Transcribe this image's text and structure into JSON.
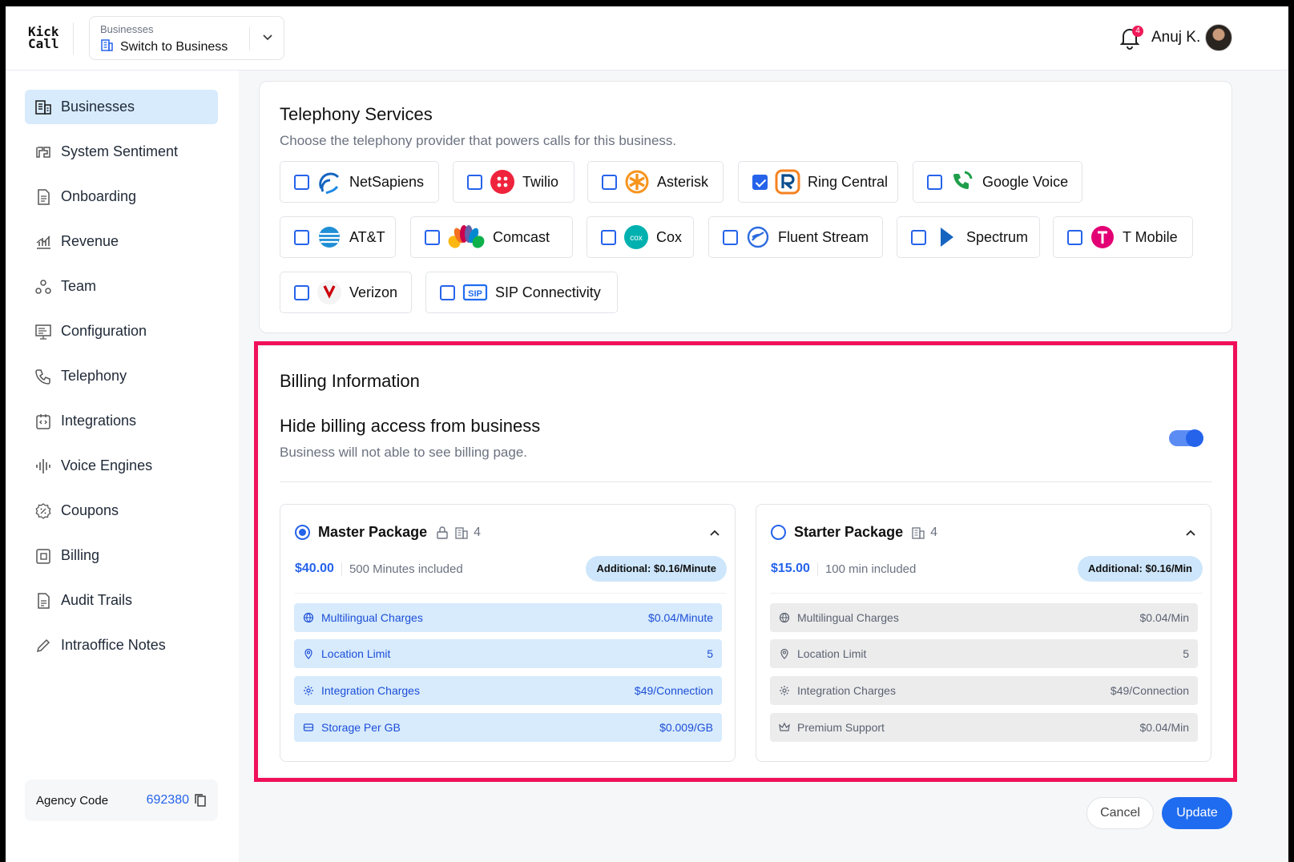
{
  "header": {
    "logo": [
      "Kick",
      "Call"
    ],
    "switcher_caption": "Businesses",
    "switcher_value": "Switch to Business",
    "notification_count": "4",
    "user_name": "Anuj K."
  },
  "sidebar": {
    "items": [
      {
        "label": "Businesses",
        "icon": "building-icon"
      },
      {
        "label": "System Sentiment",
        "icon": "sentiment-icon"
      },
      {
        "label": "Onboarding",
        "icon": "document-icon"
      },
      {
        "label": "Revenue",
        "icon": "chart-icon"
      },
      {
        "label": "Team",
        "icon": "team-icon"
      },
      {
        "label": "Configuration",
        "icon": "monitor-icon"
      },
      {
        "label": "Telephony",
        "icon": "phone-icon"
      },
      {
        "label": "Integrations",
        "icon": "code-icon"
      },
      {
        "label": "Voice Engines",
        "icon": "waveform-icon"
      },
      {
        "label": "Coupons",
        "icon": "coupon-icon"
      },
      {
        "label": "Billing",
        "icon": "wallet-icon"
      },
      {
        "label": "Audit Trails",
        "icon": "file-icon"
      },
      {
        "label": "Intraoffice Notes",
        "icon": "pencil-icon"
      }
    ],
    "agency_label": "Agency Code",
    "agency_code": "692380"
  },
  "telephony": {
    "title": "Telephony Services",
    "subtitle": "Choose the telephony provider that powers calls for this business.",
    "providers": [
      {
        "name": "NetSapiens",
        "checked": false
      },
      {
        "name": "Twilio",
        "checked": false
      },
      {
        "name": "Asterisk",
        "checked": false
      },
      {
        "name": "Ring Central",
        "checked": true
      },
      {
        "name": "Google Voice",
        "checked": false
      },
      {
        "name": "AT&T",
        "checked": false
      },
      {
        "name": "Comcast",
        "checked": false
      },
      {
        "name": "Cox",
        "checked": false
      },
      {
        "name": "Fluent Stream",
        "checked": false
      },
      {
        "name": "Spectrum",
        "checked": false
      },
      {
        "name": "T Mobile",
        "checked": false
      },
      {
        "name": "Verizon",
        "checked": false
      },
      {
        "name": "SIP Connectivity",
        "checked": false
      }
    ]
  },
  "billing": {
    "title": "Billing Information",
    "toggle_title": "Hide billing access from business",
    "toggle_sub": "Business will not able to see billing page.",
    "toggle_on": true,
    "packages": [
      {
        "name": "Master Package",
        "selected": true,
        "count": "4",
        "price": "$40.00",
        "included": "500 Minutes included",
        "additional": "Additional: $0.16/Minute",
        "features": [
          {
            "label": "Multilingual Charges",
            "value": "$0.04/Minute",
            "icon": "globe-icon"
          },
          {
            "label": "Location Limit",
            "value": "5",
            "icon": "location-pin-icon"
          },
          {
            "label": "Integration Charges",
            "value": "$49/Connection",
            "icon": "gear-icon"
          },
          {
            "label": "Storage Per GB",
            "value": "$0.009/GB",
            "icon": "storage-icon"
          }
        ]
      },
      {
        "name": "Starter Package",
        "selected": false,
        "count": "4",
        "price": "$15.00",
        "included": "100 min included",
        "additional": "Additional: $0.16/Min",
        "features": [
          {
            "label": "Multilingual Charges",
            "value": "$0.04/Min",
            "icon": "globe-icon"
          },
          {
            "label": "Location Limit",
            "value": "5",
            "icon": "location-pin-icon"
          },
          {
            "label": "Integration Charges",
            "value": "$49/Connection",
            "icon": "gear-icon"
          },
          {
            "label": "Premium Support",
            "value": "$0.04/Min",
            "icon": "crown-icon"
          }
        ]
      }
    ]
  },
  "actions": {
    "cancel": "Cancel",
    "update": "Update"
  },
  "colors": {
    "accent": "#2563eb",
    "highlight_border": "#f0105a",
    "active_nav": "#d7ebfc"
  }
}
